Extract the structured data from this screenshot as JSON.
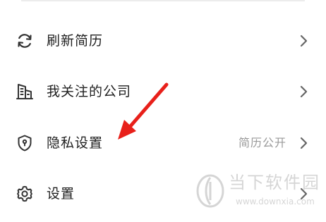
{
  "menu": {
    "items": [
      {
        "label": "刷新简历",
        "value": "",
        "icon": "refresh-icon"
      },
      {
        "label": "我关注的公司",
        "value": "",
        "icon": "building-icon"
      },
      {
        "label": "隐私设置",
        "value": "简历公开",
        "icon": "shield-icon"
      },
      {
        "label": "设置",
        "value": "",
        "icon": "gear-icon"
      }
    ]
  },
  "annotation": {
    "color": "#e8201a",
    "icon": "red-arrow-icon"
  },
  "watermark": {
    "title": "当下软件园",
    "url": "www.downxia.com"
  }
}
